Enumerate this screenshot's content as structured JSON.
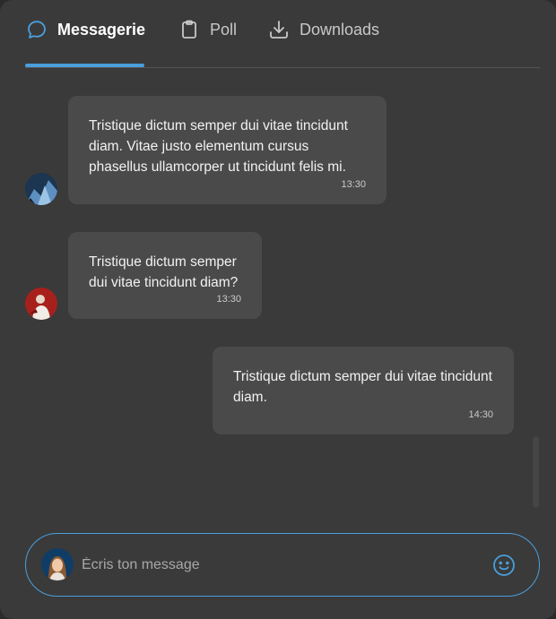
{
  "tabs": [
    {
      "label": "Messagerie",
      "icon": "chat-bubble-icon",
      "active": true
    },
    {
      "label": "Poll",
      "icon": "clipboard-icon",
      "active": false
    },
    {
      "label": "Downloads",
      "icon": "download-icon",
      "active": false
    }
  ],
  "messages": [
    {
      "text": "Tristique dictum semper dui vitae tincidunt diam. Vitae justo elementum cursus phasellus ullamcorper ut tincidunt felis mi.",
      "time": "13:30",
      "side": "left"
    },
    {
      "text": "Tristique dictum semper dui vitae tincidunt diam?",
      "time": "13:30",
      "side": "left"
    },
    {
      "text": "Tristique dictum semper dui vitae tincidunt diam.",
      "time": "14:30",
      "side": "right"
    }
  ],
  "composer": {
    "placeholder": "Écris ton message",
    "value": "",
    "emoji_icon": "smiley-icon"
  },
  "colors": {
    "accent": "#4a9fdc",
    "background": "#3a3a3a",
    "bubble": "#4a4a4a"
  }
}
